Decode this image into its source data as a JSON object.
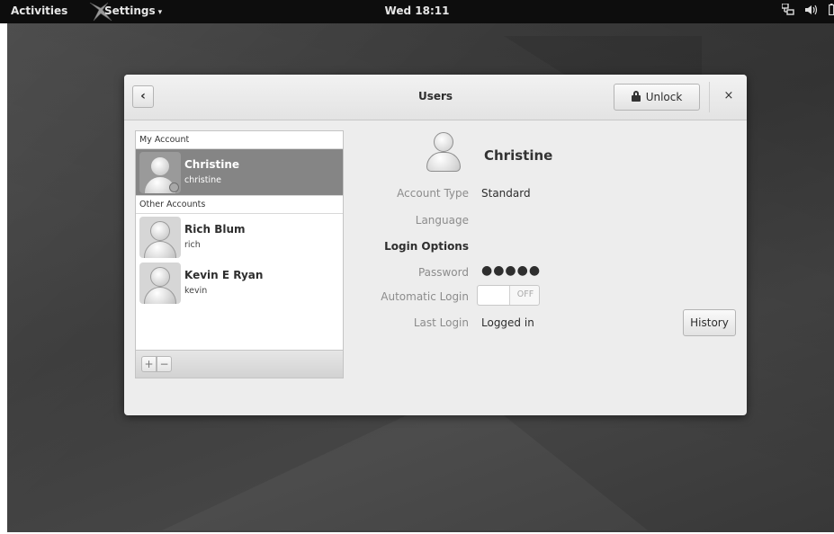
{
  "topbar": {
    "activities": "Activities",
    "app_menu": "Settings",
    "app_menu_arrow": "▾",
    "clock": "Wed 18:11",
    "tray_icons": [
      "network-icon",
      "volume-icon",
      "battery-icon"
    ]
  },
  "dialog": {
    "title": "Users",
    "back_label": "‹",
    "unlock_label": "Unlock",
    "close_label": "×"
  },
  "account_list": {
    "my_account_header": "My Account",
    "other_accounts_header": "Other Accounts",
    "accounts": [
      {
        "name": "Christine",
        "username": "christine",
        "selected": true
      },
      {
        "name": "Rich Blum",
        "username": "rich",
        "selected": false
      },
      {
        "name": "Kevin E Ryan",
        "username": "kevin",
        "selected": false
      }
    ],
    "add_label": "+",
    "remove_label": "−"
  },
  "details": {
    "name": "Christine",
    "account_type_label": "Account Type",
    "account_type_value": "Standard",
    "language_label": "Language",
    "language_value": "",
    "login_options_heading": "Login Options",
    "password_label": "Password",
    "password_value": "●●●●●",
    "automatic_login_label": "Automatic Login",
    "automatic_login_state": "OFF",
    "last_login_label": "Last Login",
    "last_login_value": "Logged in",
    "history_label": "History"
  }
}
